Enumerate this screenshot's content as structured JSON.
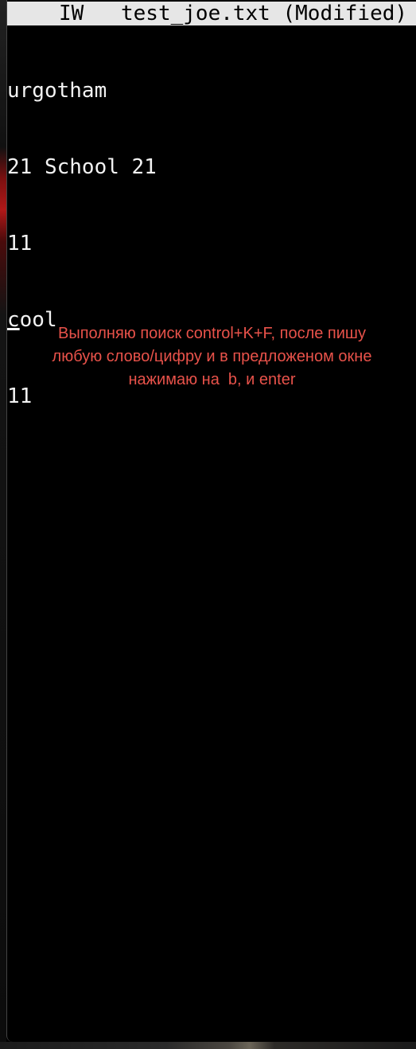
{
  "status_bar": {
    "mode": "IW",
    "filename": "test_joe.txt (Modified)"
  },
  "editor": {
    "lines": [
      "urgotham",
      "21 School 21",
      "11",
      "cool",
      "11"
    ],
    "cursor": {
      "line": 4,
      "column": 1,
      "char": "c",
      "rest": "ool"
    }
  },
  "annotation": {
    "lines": [
      "Выполняю поиск control+K+F, после пишу",
      "любую слово/цифру и в предложеном окне",
      "нажимаю на  b, и enter"
    ],
    "color": "#e8524a"
  }
}
